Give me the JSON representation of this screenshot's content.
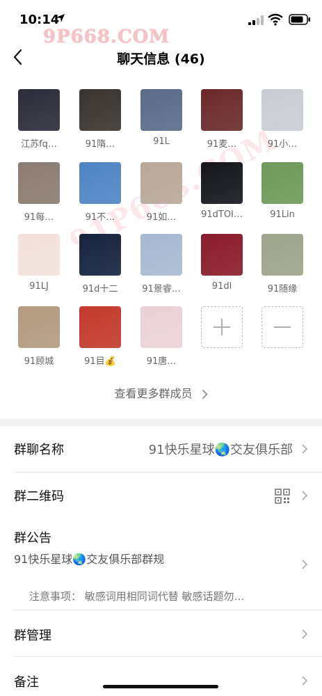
{
  "status": {
    "time": "10:14"
  },
  "watermark": {
    "top": "9P668.COM",
    "diag": "91P668.COM"
  },
  "nav": {
    "title": "聊天信息 (46)"
  },
  "members": [
    {
      "name": "江苏fq…",
      "bg": "#2c2c3a"
    },
    {
      "name": "91隋…",
      "bg": "#3a3430"
    },
    {
      "name": "91L",
      "bg": "#5a6c8a"
    },
    {
      "name": "91麦…",
      "bg": "#6b2a2a"
    },
    {
      "name": "91小…",
      "bg": "#c9cdd2"
    },
    {
      "name": "91每…",
      "bg": "#8a7c72"
    },
    {
      "name": "91不…",
      "bg": "#4f84c4"
    },
    {
      "name": "91如…",
      "bg": "#b8a89a"
    },
    {
      "name": "91dTOI…",
      "bg": "#14161c"
    },
    {
      "name": "91Lin",
      "bg": "#6e9a5a"
    },
    {
      "name": "91LJ",
      "bg": "#f1e3dc"
    },
    {
      "name": "91d十二",
      "bg": "#15233e"
    },
    {
      "name": "91景睿…",
      "bg": "#a9b9d2"
    },
    {
      "name": "91dl",
      "bg": "#8a1c2a"
    },
    {
      "name": "91随缘",
      "bg": "#9ea48a"
    },
    {
      "name": "91顾城",
      "bg": "#b39a80"
    },
    {
      "name": "91目💰",
      "bg": "#c23a2c"
    },
    {
      "name": "91唐…",
      "bg": "#e8d3d6"
    }
  ],
  "more_members": "查看更多群成员",
  "rows": {
    "group_name": {
      "label": "群聊名称",
      "value": "91快乐星球🌏交友俱乐部"
    },
    "qr": {
      "label": "群二维码"
    },
    "notice": {
      "label": "群公告",
      "subtitle": "91快乐星球🌏交友俱乐部群规",
      "note": "注意事项：  敏感词用相同词代替  敏感话题勿…"
    },
    "manage": {
      "label": "群管理"
    },
    "remark": {
      "label": "备注"
    }
  }
}
